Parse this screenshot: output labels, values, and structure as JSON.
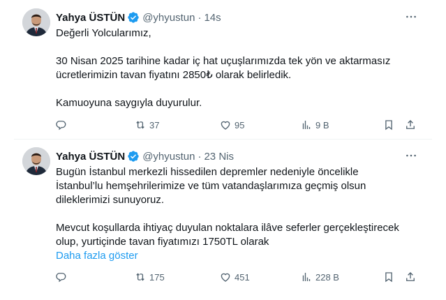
{
  "tweets": [
    {
      "author": {
        "name": "Yahya ÜSTÜN",
        "handle": "@yhyustun",
        "verified": true
      },
      "timestamp": "14s",
      "body": [
        "Değerli Yolcularımız,",
        "",
        "30 Nisan 2025 tarihine kadar iç hat uçuşlarımızda tek yön ve aktarmasız",
        "ücretlerimizin tavan fiyatını 2850₺ olarak belirledik.",
        "",
        "Kamuoyuna saygıyla duyurulur."
      ],
      "stats": {
        "replies": "",
        "retweets": "37",
        "likes": "95",
        "views": "9 B"
      }
    },
    {
      "author": {
        "name": "Yahya ÜSTÜN",
        "handle": "@yhyustun",
        "verified": true
      },
      "timestamp": "23 Nis",
      "body": [
        "Bugün İstanbul merkezli hissedilen depremler nedeniyle öncelikle",
        "İstanbul’lu hemşehrilerimize ve tüm vatandaşlarımıza geçmiş olsun",
        "dileklerimizi sunuyoruz.",
        "",
        "Mevcut koşullarda ihtiyaç duyulan noktalara ilâve seferler gerçekleştirecek",
        "olup, yurtiçinde tavan fiyatımızı 1750TL olarak"
      ],
      "show_more": "Daha fazla göster",
      "stats": {
        "replies": "",
        "retweets": "175",
        "likes": "451",
        "views": "228 B"
      }
    }
  ],
  "separator": "·",
  "colors": {
    "text": "#0f1419",
    "secondary": "#536471",
    "link": "#1d9bf0",
    "verified": "#1d9bf0",
    "border": "#eff3f4"
  },
  "icons": [
    "more-icon",
    "verified-badge-icon",
    "reply-icon",
    "retweet-icon",
    "like-icon",
    "views-icon",
    "bookmark-icon",
    "share-icon"
  ]
}
